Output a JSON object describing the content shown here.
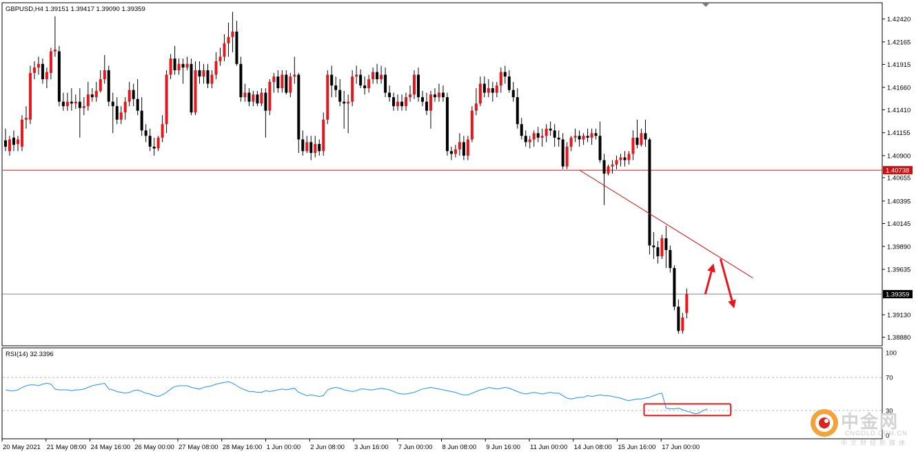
{
  "chart_data": {
    "type": "candlestick",
    "title": "GBPUSD,H4  1.39151 1.39417 1.39090 1.39359",
    "symbol": "GBPUSD,H4",
    "ohlc_text": "1.39151 1.39417 1.39090 1.39359",
    "colors": {
      "up": "#e8161b",
      "down": "#000000",
      "wick": "#000000",
      "level": "#d01010",
      "current": "#808080",
      "rsi": "#1e90ff"
    },
    "ylim": [
      1.388,
      1.4257
    ],
    "y_ticks": [
      "1.42420",
      "1.42165",
      "1.41915",
      "1.41660",
      "1.41410",
      "1.41155",
      "1.40900",
      "1.40655",
      "1.40395",
      "1.40145",
      "1.39890",
      "1.39635",
      "1.39130",
      "1.38880"
    ],
    "x_ticks": [
      "20 May 2021",
      "21 May 08:00",
      "24 May 16:00",
      "26 May 00:00",
      "27 May 08:00",
      "28 May 16:00",
      "1 Jun 00:00",
      "2 Jun 08:00",
      "3 Jun 16:00",
      "7 Jun 00:00",
      "8 Jun 08:00",
      "9 Jun 16:00",
      "11 Jun 00:00",
      "14 Jun 08:00",
      "15 Jun 16:00",
      "17 Jun 00:00"
    ],
    "horizontal_level": {
      "label": "1.40738",
      "value": 1.40738
    },
    "current_price": {
      "label": "1.39359",
      "value": 1.39359
    },
    "trendline": {
      "start": {
        "bar": 139,
        "price": 1.4074
      },
      "end": {
        "bar": 181,
        "price": 1.3954
      }
    },
    "arrows": [
      {
        "from": {
          "bar": 169.5,
          "price": 1.3936
        },
        "to": {
          "bar": 171.5,
          "price": 1.397
        }
      },
      {
        "from": {
          "bar": 173.2,
          "price": 1.3975
        },
        "to": {
          "bar": 176.5,
          "price": 1.392
        }
      }
    ],
    "candles": [
      [
        1.4107,
        1.412,
        1.41,
        1.4095
      ],
      [
        1.4095,
        1.4112,
        1.4108,
        1.409
      ],
      [
        1.411,
        1.4118,
        1.4102,
        1.4095
      ],
      [
        1.4103,
        1.4112,
        1.4108,
        1.4095
      ],
      [
        1.41,
        1.4135,
        1.413,
        1.4095
      ],
      [
        1.413,
        1.4145,
        1.4132,
        1.412
      ],
      [
        1.413,
        1.419,
        1.4182,
        1.4125
      ],
      [
        1.4182,
        1.4195,
        1.4188,
        1.4175
      ],
      [
        1.4188,
        1.42,
        1.4192,
        1.418
      ],
      [
        1.4192,
        1.4198,
        1.4175,
        1.417
      ],
      [
        1.4175,
        1.4188,
        1.4183,
        1.4165
      ],
      [
        1.4182,
        1.421,
        1.4206,
        1.4175
      ],
      [
        1.4206,
        1.4245,
        1.4208,
        1.42
      ],
      [
        1.4206,
        1.4212,
        1.415,
        1.4145
      ],
      [
        1.415,
        1.416,
        1.4145,
        1.414
      ],
      [
        1.4145,
        1.416,
        1.415,
        1.414
      ],
      [
        1.415,
        1.4165,
        1.4148,
        1.414
      ],
      [
        1.4148,
        1.4158,
        1.415,
        1.4142
      ],
      [
        1.415,
        1.4165,
        1.4143,
        1.411
      ],
      [
        1.4143,
        1.4155,
        1.4145,
        1.4135
      ],
      [
        1.4145,
        1.4172,
        1.4158,
        1.414
      ],
      [
        1.4158,
        1.4165,
        1.4155,
        1.415
      ],
      [
        1.4155,
        1.4172,
        1.4162,
        1.415
      ],
      [
        1.4162,
        1.4185,
        1.4175,
        1.416
      ],
      [
        1.4175,
        1.4202,
        1.4185,
        1.417
      ],
      [
        1.4185,
        1.419,
        1.415,
        1.4145
      ],
      [
        1.415,
        1.416,
        1.4145,
        1.4115
      ],
      [
        1.4145,
        1.4155,
        1.413,
        1.4125
      ],
      [
        1.413,
        1.4145,
        1.4138,
        1.4125
      ],
      [
        1.4138,
        1.4155,
        1.415,
        1.413
      ],
      [
        1.415,
        1.4172,
        1.4163,
        1.4145
      ],
      [
        1.4163,
        1.417,
        1.4153,
        1.4145
      ],
      [
        1.4153,
        1.4175,
        1.414,
        1.4135
      ],
      [
        1.414,
        1.4155,
        1.4118,
        1.4112
      ],
      [
        1.4118,
        1.4125,
        1.4112,
        1.4105
      ],
      [
        1.4112,
        1.412,
        1.41,
        1.4095
      ],
      [
        1.41,
        1.411,
        1.4098,
        1.409
      ],
      [
        1.4098,
        1.4112,
        1.411,
        1.4095
      ],
      [
        1.411,
        1.4135,
        1.4125,
        1.4105
      ],
      [
        1.4125,
        1.4185,
        1.418,
        1.4115
      ],
      [
        1.418,
        1.4203,
        1.4198,
        1.4175
      ],
      [
        1.4198,
        1.4212,
        1.4185,
        1.418
      ],
      [
        1.4185,
        1.4198,
        1.4192,
        1.418
      ],
      [
        1.4192,
        1.4198,
        1.4188,
        1.417
      ],
      [
        1.4188,
        1.42,
        1.4192,
        1.4185
      ],
      [
        1.4192,
        1.4198,
        1.4138,
        1.4135
      ],
      [
        1.4138,
        1.4195,
        1.4185,
        1.4135
      ],
      [
        1.4185,
        1.4195,
        1.4178,
        1.417
      ],
      [
        1.4178,
        1.4192,
        1.4185,
        1.417
      ],
      [
        1.4185,
        1.4192,
        1.417,
        1.4165
      ],
      [
        1.417,
        1.4185,
        1.418,
        1.4165
      ],
      [
        1.418,
        1.4205,
        1.4195,
        1.4175
      ],
      [
        1.4195,
        1.421,
        1.42,
        1.419
      ],
      [
        1.42,
        1.4225,
        1.4215,
        1.4195
      ],
      [
        1.4215,
        1.4238,
        1.4222,
        1.42
      ],
      [
        1.4222,
        1.425,
        1.4228,
        1.4205
      ],
      [
        1.4228,
        1.424,
        1.4192,
        1.419
      ],
      [
        1.4192,
        1.42,
        1.4155,
        1.415
      ],
      [
        1.4155,
        1.417,
        1.416,
        1.415
      ],
      [
        1.416,
        1.4165,
        1.415,
        1.4145
      ],
      [
        1.415,
        1.4162,
        1.4158,
        1.4145
      ],
      [
        1.4158,
        1.4162,
        1.4148,
        1.4145
      ],
      [
        1.4148,
        1.4165,
        1.416,
        1.4145
      ],
      [
        1.416,
        1.4165,
        1.414,
        1.411
      ],
      [
        1.414,
        1.4175,
        1.4172,
        1.4135
      ],
      [
        1.4172,
        1.4182,
        1.4178,
        1.416
      ],
      [
        1.4178,
        1.4185,
        1.4165,
        1.416
      ],
      [
        1.4165,
        1.4185,
        1.418,
        1.416
      ],
      [
        1.418,
        1.4185,
        1.416,
        1.4158
      ],
      [
        1.416,
        1.4182,
        1.4178,
        1.4155
      ],
      [
        1.4178,
        1.42,
        1.418,
        1.417
      ],
      [
        1.418,
        1.4182,
        1.4108,
        1.4093
      ],
      [
        1.4108,
        1.4118,
        1.4095,
        1.409
      ],
      [
        1.4095,
        1.4112,
        1.4105,
        1.4093
      ],
      [
        1.4105,
        1.4112,
        1.4093,
        1.4085
      ],
      [
        1.4093,
        1.4112,
        1.4103,
        1.4088
      ],
      [
        1.4103,
        1.4108,
        1.4095,
        1.409
      ],
      [
        1.4095,
        1.4138,
        1.413,
        1.409
      ],
      [
        1.413,
        1.4185,
        1.418,
        1.4125
      ],
      [
        1.418,
        1.419,
        1.4168,
        1.4155
      ],
      [
        1.4168,
        1.4178,
        1.4163,
        1.4155
      ],
      [
        1.4163,
        1.4175,
        1.415,
        1.4145
      ],
      [
        1.415,
        1.4162,
        1.4148,
        1.412
      ],
      [
        1.4148,
        1.4158,
        1.415,
        1.4115
      ],
      [
        1.415,
        1.4185,
        1.4178,
        1.4145
      ],
      [
        1.4178,
        1.419,
        1.418,
        1.417
      ],
      [
        1.418,
        1.4186,
        1.4168,
        1.4165
      ],
      [
        1.4168,
        1.4178,
        1.4165,
        1.4158
      ],
      [
        1.4165,
        1.418,
        1.4175,
        1.416
      ],
      [
        1.4175,
        1.4188,
        1.4183,
        1.417
      ],
      [
        1.4183,
        1.4192,
        1.4175,
        1.417
      ],
      [
        1.4175,
        1.419,
        1.418,
        1.417
      ],
      [
        1.418,
        1.4188,
        1.416,
        1.4155
      ],
      [
        1.416,
        1.4168,
        1.4155,
        1.415
      ],
      [
        1.4155,
        1.416,
        1.4145,
        1.414
      ],
      [
        1.4145,
        1.4158,
        1.415,
        1.414
      ],
      [
        1.415,
        1.4158,
        1.4145,
        1.414
      ],
      [
        1.4145,
        1.416,
        1.4155,
        1.414
      ],
      [
        1.4155,
        1.4168,
        1.4158,
        1.415
      ],
      [
        1.4158,
        1.4185,
        1.418,
        1.4153
      ],
      [
        1.418,
        1.4188,
        1.4155,
        1.415
      ],
      [
        1.4155,
        1.4162,
        1.415,
        1.4145
      ],
      [
        1.415,
        1.416,
        1.414,
        1.4135
      ],
      [
        1.414,
        1.4162,
        1.4158,
        1.412
      ],
      [
        1.4158,
        1.4165,
        1.4155,
        1.415
      ],
      [
        1.4155,
        1.417,
        1.416,
        1.415
      ],
      [
        1.416,
        1.4168,
        1.4155,
        1.415
      ],
      [
        1.4155,
        1.416,
        1.4095,
        1.409
      ],
      [
        1.4095,
        1.41,
        1.4092,
        1.4085
      ],
      [
        1.4092,
        1.4102,
        1.4097,
        1.4088
      ],
      [
        1.4097,
        1.4115,
        1.4105,
        1.409
      ],
      [
        1.4105,
        1.4112,
        1.409,
        1.4085
      ],
      [
        1.409,
        1.4112,
        1.4108,
        1.4085
      ],
      [
        1.4108,
        1.4145,
        1.414,
        1.4105
      ],
      [
        1.414,
        1.4165,
        1.4148,
        1.4135
      ],
      [
        1.4148,
        1.4178,
        1.417,
        1.4145
      ],
      [
        1.417,
        1.4178,
        1.416,
        1.4155
      ],
      [
        1.416,
        1.4175,
        1.4165,
        1.4155
      ],
      [
        1.4165,
        1.4172,
        1.416,
        1.415
      ],
      [
        1.416,
        1.4172,
        1.4168,
        1.4155
      ],
      [
        1.4168,
        1.4188,
        1.4183,
        1.416
      ],
      [
        1.4183,
        1.419,
        1.4178,
        1.417
      ],
      [
        1.4178,
        1.4185,
        1.4163,
        1.416
      ],
      [
        1.4163,
        1.4172,
        1.4155,
        1.415
      ],
      [
        1.4155,
        1.4165,
        1.4125,
        1.412
      ],
      [
        1.4125,
        1.4132,
        1.4112,
        1.4108
      ],
      [
        1.4112,
        1.4118,
        1.4105,
        1.41
      ],
      [
        1.4105,
        1.4112,
        1.4108,
        1.4098
      ],
      [
        1.4108,
        1.4118,
        1.4115,
        1.41
      ],
      [
        1.4115,
        1.4122,
        1.411,
        1.4105
      ],
      [
        1.411,
        1.412,
        1.4112,
        1.41
      ],
      [
        1.4112,
        1.4125,
        1.412,
        1.4105
      ],
      [
        1.412,
        1.4128,
        1.4118,
        1.4112
      ],
      [
        1.4118,
        1.4125,
        1.411,
        1.41
      ],
      [
        1.411,
        1.4118,
        1.4108,
        1.41
      ],
      [
        1.4108,
        1.4115,
        1.4078,
        1.4075
      ],
      [
        1.4078,
        1.4105,
        1.41,
        1.4075
      ],
      [
        1.41,
        1.4112,
        1.411,
        1.4095
      ],
      [
        1.411,
        1.412,
        1.4112,
        1.4105
      ],
      [
        1.4112,
        1.4118,
        1.4108,
        1.41
      ],
      [
        1.4108,
        1.4115,
        1.4112,
        1.4102
      ],
      [
        1.4112,
        1.412,
        1.411,
        1.4105
      ],
      [
        1.411,
        1.412,
        1.4115,
        1.4102
      ],
      [
        1.4115,
        1.412,
        1.4112,
        1.4108
      ],
      [
        1.4112,
        1.4128,
        1.4085,
        1.4082
      ],
      [
        1.4085,
        1.4092,
        1.407,
        1.4035
      ],
      [
        1.407,
        1.408,
        1.4078,
        1.4068
      ],
      [
        1.4078,
        1.4085,
        1.408,
        1.407
      ],
      [
        1.408,
        1.409,
        1.4085,
        1.4075
      ],
      [
        1.4085,
        1.4092,
        1.4088,
        1.4078
      ],
      [
        1.4088,
        1.4095,
        1.4085,
        1.4078
      ],
      [
        1.4085,
        1.4095,
        1.4092,
        1.408
      ],
      [
        1.4092,
        1.4118,
        1.411,
        1.4085
      ],
      [
        1.411,
        1.413,
        1.4102,
        1.4098
      ],
      [
        1.4102,
        1.412,
        1.4115,
        1.41
      ],
      [
        1.4115,
        1.413,
        1.4108,
        1.41
      ],
      [
        1.4108,
        1.411,
        1.399,
        1.398
      ],
      [
        1.399,
        1.4005,
        1.3988,
        1.3975
      ],
      [
        1.3988,
        1.3995,
        1.3978,
        1.397
      ],
      [
        1.3978,
        1.4002,
        1.3998,
        1.3975
      ],
      [
        1.3998,
        1.4012,
        1.3985,
        1.3965
      ],
      [
        1.3985,
        1.399,
        1.3965,
        1.396
      ],
      [
        1.3965,
        1.3968,
        1.3922,
        1.3918
      ],
      [
        1.3922,
        1.393,
        1.3895,
        1.3892
      ],
      [
        1.3895,
        1.3915,
        1.391,
        1.3892
      ],
      [
        1.3915,
        1.3942,
        1.3936,
        1.3909
      ]
    ]
  },
  "rsi": {
    "label": "RSI(14) 32.3396",
    "ylim": [
      0,
      100
    ],
    "levels": [
      70,
      30
    ],
    "tick_labels": [
      "100",
      "70",
      "30",
      "0"
    ],
    "values": [
      55,
      54,
      54,
      55,
      58,
      60,
      61,
      61,
      60,
      62,
      63,
      62,
      56,
      55,
      55,
      55,
      54,
      55,
      55,
      56,
      58,
      60,
      61,
      62,
      63,
      56,
      55,
      53,
      52,
      51,
      52,
      54,
      55,
      53,
      51,
      50,
      48,
      47,
      49,
      52,
      56,
      59,
      60,
      60,
      60,
      58,
      57,
      56,
      58,
      59,
      60,
      62,
      63,
      64,
      65,
      63,
      60,
      57,
      55,
      53,
      53,
      52,
      52,
      54,
      53,
      54,
      55,
      56,
      55,
      56,
      57,
      52,
      50,
      48,
      49,
      48,
      47,
      48,
      55,
      57,
      58,
      57,
      55,
      54,
      53,
      54,
      56,
      56,
      55,
      55,
      56,
      57,
      56,
      55,
      53,
      51,
      50,
      50,
      51,
      52,
      54,
      56,
      57,
      58,
      57,
      56,
      55,
      54,
      53,
      52,
      50,
      49,
      49,
      51,
      53,
      55,
      56,
      58,
      57,
      56,
      57,
      58,
      57,
      55,
      53,
      51,
      50,
      51,
      52,
      51,
      50,
      51,
      52,
      51,
      51,
      48,
      45,
      44,
      45,
      46,
      46,
      48,
      47,
      48,
      49,
      48,
      48,
      47,
      46,
      45,
      43,
      42,
      43,
      44,
      44,
      45,
      46,
      48,
      50,
      51,
      33,
      32,
      32,
      33,
      31,
      29,
      28,
      26,
      27,
      30,
      32
    ]
  },
  "annotation_box": {
    "color": "#e8161b",
    "rsi_range": [
      24,
      38
    ]
  },
  "watermark": {
    "brand": "中金网",
    "url": "CNGOLD.COM.CN",
    "subtitle": "中文财经新媒体"
  }
}
